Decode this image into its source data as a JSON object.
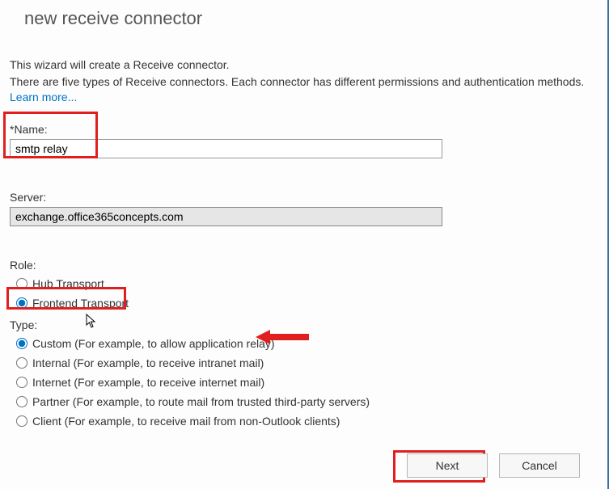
{
  "title": "new receive connector",
  "intro_line1": "This wizard will create a Receive connector.",
  "intro_line2_prefix": "There are five types of Receive connectors. Each connector has different permissions and authentication methods. ",
  "learn_more": "Learn more...",
  "name": {
    "label": "*Name:",
    "value": "smtp relay"
  },
  "server": {
    "label": "Server:",
    "value": "exchange.office365concepts.com"
  },
  "role": {
    "label": "Role:",
    "options": [
      {
        "label": "Hub Transport",
        "checked": false
      },
      {
        "label": "Frontend Transport",
        "checked": true
      }
    ]
  },
  "type": {
    "label": "Type:",
    "options": [
      {
        "label": "Custom (For example, to allow application relay)",
        "checked": true
      },
      {
        "label": "Internal (For example, to receive intranet mail)",
        "checked": false
      },
      {
        "label": "Internet (For example, to receive internet mail)",
        "checked": false
      },
      {
        "label": "Partner (For example, to route mail from trusted third-party servers)",
        "checked": false
      },
      {
        "label": "Client (For example, to receive mail from non-Outlook clients)",
        "checked": false
      }
    ]
  },
  "buttons": {
    "next": "Next",
    "cancel": "Cancel"
  },
  "annotations": {
    "highlight_color": "#e02020"
  }
}
